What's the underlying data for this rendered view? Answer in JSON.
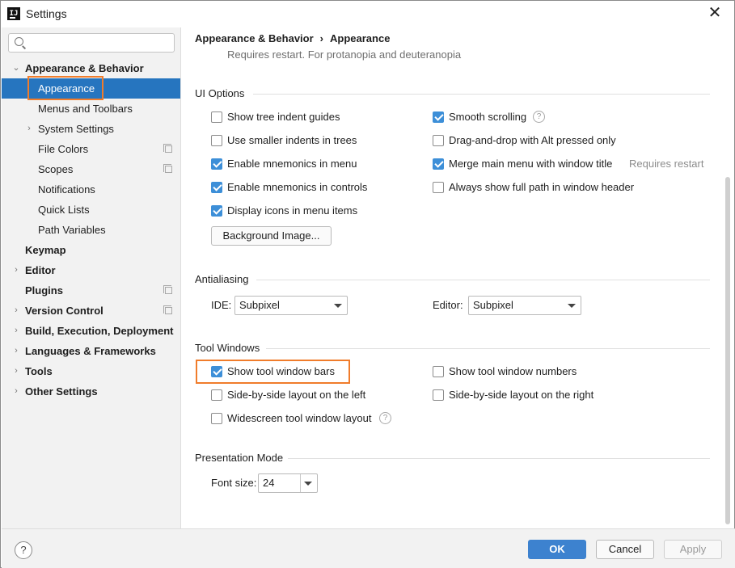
{
  "window": {
    "title": "Settings",
    "app_icon": "intellij-icon",
    "close_glyph": "✕"
  },
  "sidebar": {
    "search": {
      "placeholder": "",
      "value": ""
    },
    "tree": [
      {
        "label": "Appearance & Behavior",
        "expanded": true,
        "bold": true
      },
      {
        "label": "Appearance",
        "selected": true
      },
      {
        "label": "Menus and Toolbars"
      },
      {
        "label": "System Settings",
        "expandable": true
      },
      {
        "label": "File Colors",
        "project_icon": true
      },
      {
        "label": "Scopes",
        "project_icon": true
      },
      {
        "label": "Notifications"
      },
      {
        "label": "Quick Lists"
      },
      {
        "label": "Path Variables"
      },
      {
        "label": "Keymap",
        "bold": true
      },
      {
        "label": "Editor",
        "bold": true,
        "expandable": true
      },
      {
        "label": "Plugins",
        "bold": true,
        "project_icon": true
      },
      {
        "label": "Version Control",
        "bold": true,
        "expandable": true,
        "project_icon": true
      },
      {
        "label": "Build, Execution, Deployment",
        "bold": true,
        "expandable": true
      },
      {
        "label": "Languages & Frameworks",
        "bold": true,
        "expandable": true
      },
      {
        "label": "Tools",
        "bold": true,
        "expandable": true
      },
      {
        "label": "Other Settings",
        "bold": true,
        "expandable": true
      }
    ],
    "arrow_collapsed": "›",
    "arrow_expanded": "⌄"
  },
  "content": {
    "breadcrumb": {
      "parent": "Appearance & Behavior",
      "separator": "›",
      "current": "Appearance"
    },
    "subtitle": "Requires restart. For protanopia and deuteranopia",
    "ui_options": {
      "title": "UI Options",
      "left": [
        {
          "label": "Show tree indent guides",
          "checked": false
        },
        {
          "label": "Use smaller indents in trees",
          "checked": false
        },
        {
          "label": "Enable mnemonics in menu",
          "checked": true
        },
        {
          "label": "Enable mnemonics in controls",
          "checked": true
        },
        {
          "label": "Display icons in menu items",
          "checked": true
        }
      ],
      "right": [
        {
          "label": "Smooth scrolling",
          "checked": true
        },
        {
          "label": "Drag-and-drop with Alt pressed only",
          "checked": false
        },
        {
          "label": "Merge main menu with window title",
          "checked": true
        },
        {
          "label": "Always show full path in window header",
          "checked": false
        }
      ],
      "requires_restart_note": "Requires restart",
      "background_button": "Background Image..."
    },
    "antialiasing": {
      "title": "Antialiasing",
      "ide_label": "IDE:",
      "ide_value": "Subpixel",
      "editor_label": "Editor:",
      "editor_value": "Subpixel"
    },
    "tool_windows": {
      "title": "Tool Windows",
      "items": [
        {
          "label": "Show tool window bars",
          "checked": true
        },
        {
          "label": "Show tool window numbers",
          "checked": false
        },
        {
          "label": "Side-by-side layout on the left",
          "checked": false
        },
        {
          "label": "Side-by-side layout on the right",
          "checked": false
        },
        {
          "label": "Widescreen tool window layout",
          "checked": false
        }
      ]
    },
    "presentation_mode": {
      "title": "Presentation Mode",
      "font_size_label": "Font size:",
      "font_size_value": "24"
    },
    "help_glyph": "?"
  },
  "footer": {
    "help": "?",
    "ok": "OK",
    "cancel": "Cancel",
    "apply": "Apply"
  },
  "colors": {
    "selection": "#2675bf",
    "highlight": "#f07c2b",
    "checkbox": "#3d8fd8",
    "primary_button": "#3d82cf"
  }
}
